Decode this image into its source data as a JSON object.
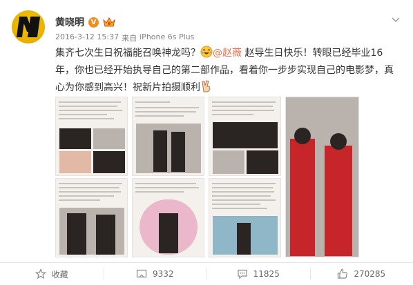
{
  "post": {
    "author": "黄晓明",
    "verified_mark": "V",
    "timestamp": "2016-3-12 15:37",
    "source_prefix": "来自",
    "source_device": "iPhone 6s Plus",
    "content": {
      "part1": "集齐七次生日祝福能召唤神龙吗？",
      "mention": "@赵薇",
      "part2": " 赵导生日快乐！转眼已经毕业16年，你也已经开始执导自己的第二部作品，看着你一步步实现自己的电影梦，真心为你感到高兴！祝新片拍摄顺利"
    },
    "icons": {
      "more": "chevron-down-icon",
      "emoji1": "laughing-emoji",
      "emoji2": "victory-hand-emoji",
      "crown": "crown-icon"
    }
  },
  "actions": {
    "favorite_label": "收藏",
    "repost_count": "9332",
    "comment_count": "11825",
    "like_count": "270285"
  },
  "colors": {
    "mention": "#eb7350",
    "verified": "#f68c1e",
    "meta": "#808080",
    "avatar": "#f4c400"
  }
}
